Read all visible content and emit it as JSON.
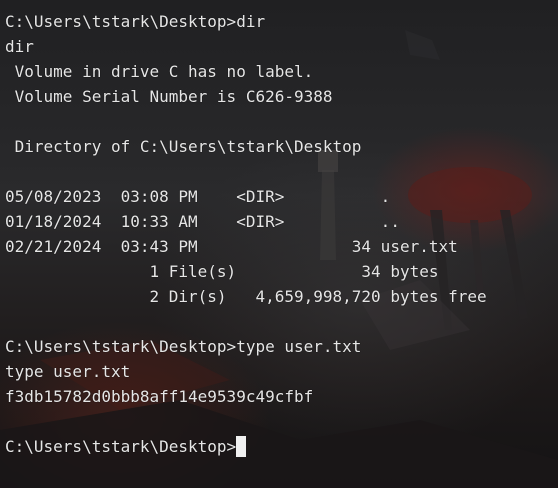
{
  "terminal": {
    "lines": [
      "C:\\Users\\tstark\\Desktop>dir",
      "dir",
      " Volume in drive C has no label.",
      " Volume Serial Number is C626-9388",
      "",
      " Directory of C:\\Users\\tstark\\Desktop",
      "",
      "05/08/2023  03:08 PM    <DIR>          .",
      "01/18/2024  10:33 AM    <DIR>          ..",
      "02/21/2024  03:43 PM                34 user.txt",
      "               1 File(s)             34 bytes",
      "               2 Dir(s)   4,659,998,720 bytes free",
      "",
      "C:\\Users\\tstark\\Desktop>type user.txt",
      "type user.txt",
      "f3db15782d0bbb8aff14e9539c49cfbf",
      ""
    ],
    "prompt": "C:\\Users\\tstark\\Desktop>"
  }
}
